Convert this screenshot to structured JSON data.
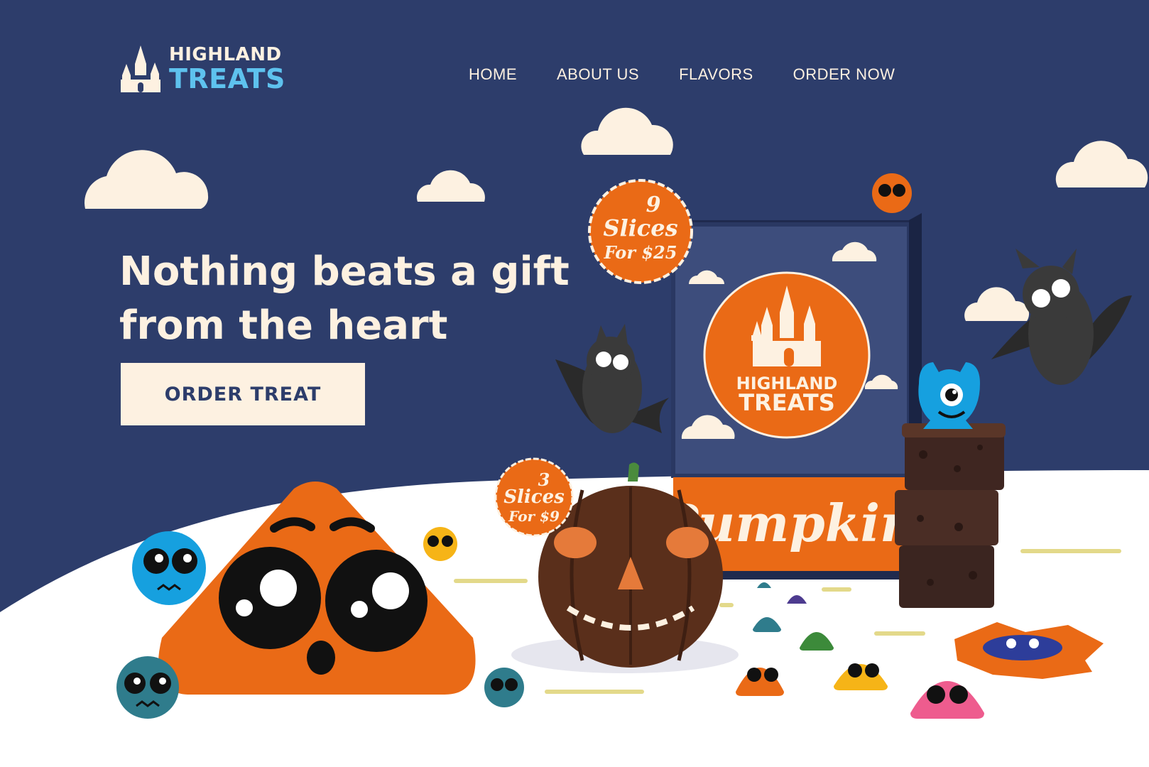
{
  "brand": {
    "line1": "HIGHLAND",
    "line2": "TREATS",
    "colors": {
      "navy": "#2d3d6b",
      "cream": "#fdf1e1",
      "orange": "#ea6a16",
      "sky": "#5ec2ee"
    }
  },
  "nav": {
    "items": [
      {
        "label": "HOME"
      },
      {
        "label": "ABOUT US"
      },
      {
        "label": "FLAVORS"
      },
      {
        "label": "ORDER NOW"
      }
    ]
  },
  "hero": {
    "headline_line1": "Nothing beats a gift",
    "headline_line2": "from the heart",
    "cta_label": "ORDER TREAT"
  },
  "products": {
    "box_logo_line1": "HIGHLAND",
    "box_logo_line2": "TREATS",
    "box_label": "Pumpkin",
    "badge_large": {
      "count": "9",
      "unit": "Slices",
      "price": "For $25"
    },
    "badge_small": {
      "count": "3",
      "unit": "Slices",
      "price": "For $9"
    }
  }
}
